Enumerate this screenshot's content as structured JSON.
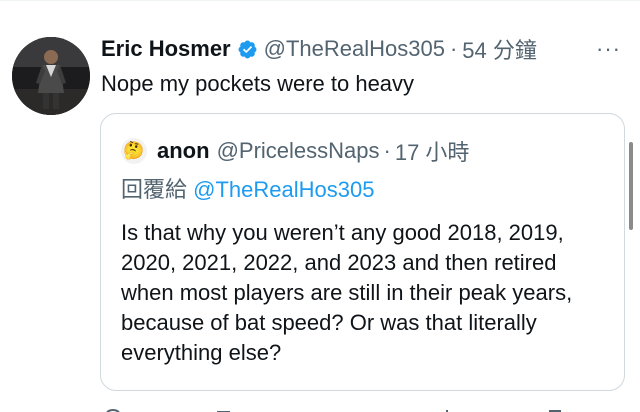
{
  "tweet": {
    "author_name": "Eric Hosmer",
    "author_handle": "@TheRealHos305",
    "separator": "·",
    "time": "54 分鐘",
    "more": "···",
    "text": "Nope my pockets were to heavy",
    "verified_color": "#1d9bf0"
  },
  "quote": {
    "author_name": "anon",
    "author_handle": "@PricelessNaps",
    "separator": "·",
    "time": "17 小時",
    "avatar_emoji": "🤔",
    "reply_prefix": "回覆給",
    "reply_handle": "@TheRealHos305",
    "text": "Is that why you weren’t any good 2018, 2019, 2020, 2021, 2022, and 2023 and then retired when most players are still in their peak years, because of bat speed? Or was that literally everything else?"
  },
  "actions": [
    "reply-icon",
    "retweet-icon",
    "like-icon",
    "views-icon",
    "bookmark-icon",
    "share-icon"
  ]
}
